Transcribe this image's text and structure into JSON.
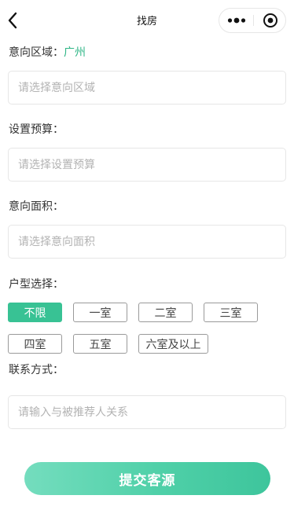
{
  "nav": {
    "title": "找房",
    "back_icon": "chevron-left-icon",
    "more_icon": "more-dots-icon",
    "close_icon": "target-circle-icon"
  },
  "form": {
    "area": {
      "label": "意向区域：",
      "city": "广州",
      "placeholder": "请选择意向区域",
      "value": ""
    },
    "budget": {
      "label": "设置预算：",
      "placeholder": "请选择设置预算",
      "value": ""
    },
    "size": {
      "label": "意向面积：",
      "placeholder": "请选择意向面积",
      "value": ""
    },
    "layout": {
      "label": "户型选择：",
      "options": [
        "不限",
        "一室",
        "二室",
        "三室",
        "四室",
        "五室",
        "六室及以上"
      ],
      "selected": "不限"
    },
    "contact": {
      "label": "联系方式：",
      "placeholder": "请输入与被推荐人关系",
      "value": ""
    }
  },
  "submit_label": "提交客源",
  "colors": {
    "accent": "#2fb686",
    "chip_selected": "#38c294",
    "button_start": "#74ddbe",
    "button_end": "#3ec59c"
  }
}
